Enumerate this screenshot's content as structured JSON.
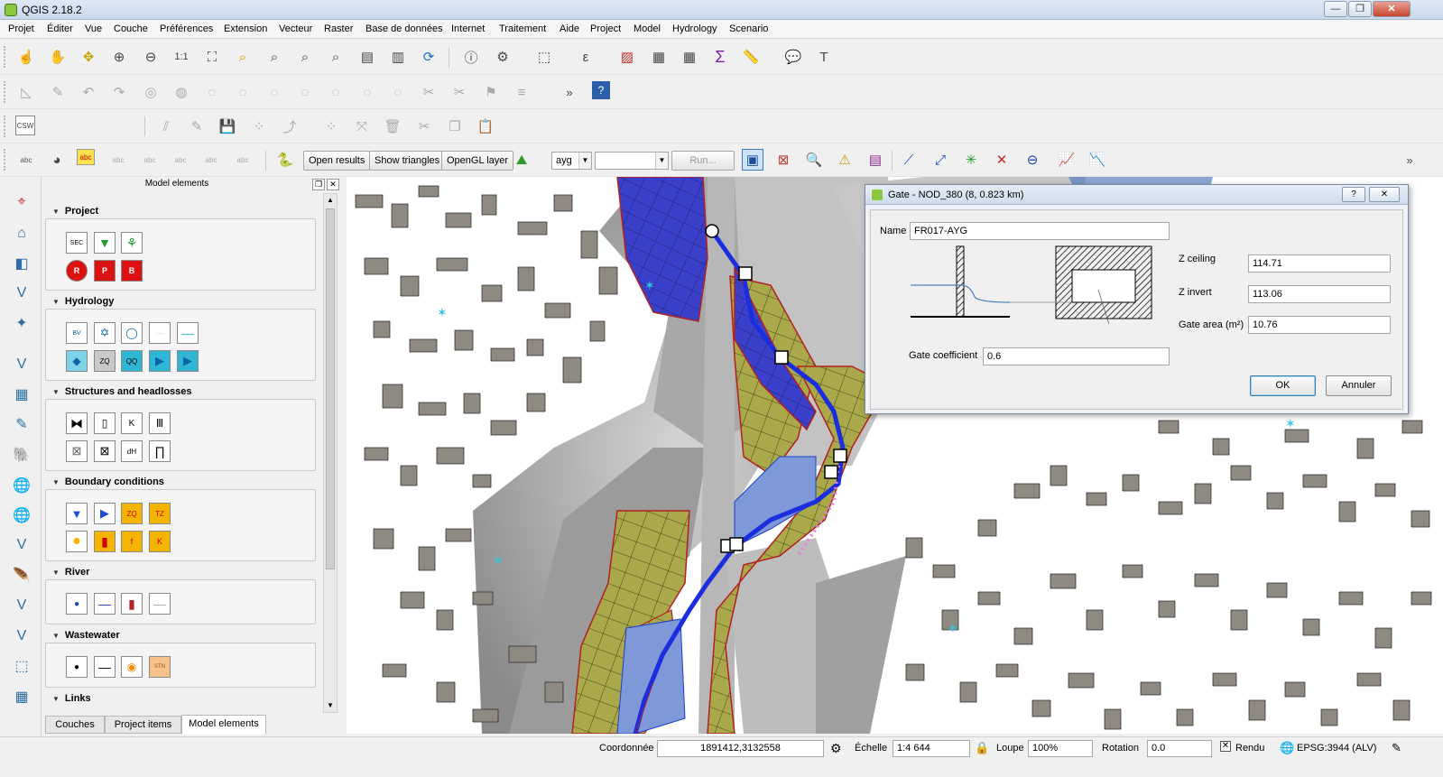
{
  "window": {
    "title": "QGIS 2.18.2"
  },
  "menu": [
    "Projet",
    "Éditer",
    "Vue",
    "Couche",
    "Préférences",
    "Extension",
    "Vecteur",
    "Raster",
    "Base de données",
    "Internet",
    "Traitement",
    "Aide",
    "Project",
    "Model",
    "Hydrology",
    "Scenario"
  ],
  "toolbar": {
    "csw_label": "CSW",
    "abc_label": "abc",
    "open_results": "Open results",
    "show_triangles": "Show triangles",
    "opengl_layer": "OpenGL layer",
    "scenario_value": "ayg",
    "model_value": "",
    "run_label": "Run...",
    "more": "»"
  },
  "panel": {
    "title": "Model elements",
    "groups": [
      {
        "name": "Project",
        "items": [
          "SEC",
          "filter",
          "tree",
          "R",
          "P",
          "B"
        ]
      },
      {
        "name": "Hydrology",
        "items": [
          "BV",
          "star",
          "circle",
          "dotted-line",
          "line",
          "diamond",
          "ZQ",
          "QQ",
          "arrow-q",
          "arrow-t"
        ]
      },
      {
        "name": "Structures and headlosses",
        "items": [
          "gate",
          "weir",
          "K",
          "grid",
          "gate-x",
          "valve",
          "dH",
          "bridge"
        ]
      },
      {
        "name": "Boundary conditions",
        "items": [
          "tri-down",
          "tri-right",
          "ZQ",
          "TZ",
          "circle",
          "wall",
          "f",
          "K"
        ]
      },
      {
        "name": "River",
        "items": [
          "node",
          "reach",
          "cross-section",
          "dash"
        ]
      },
      {
        "name": "Wastewater",
        "items": [
          "node",
          "pipe",
          "manhole",
          "STN"
        ]
      },
      {
        "name": "Links",
        "items": []
      }
    ],
    "tabs": [
      "Couches",
      "Project items",
      "Model elements"
    ],
    "active_tab": "Model elements"
  },
  "dialog": {
    "title": "Gate - NOD_380 (8, 0.823 km)",
    "help": "?",
    "name_label": "Name",
    "name_value": "FR017-AYG",
    "z_ceiling_label": "Z ceiling",
    "z_ceiling_value": "114.71",
    "z_invert_label": "Z invert",
    "z_invert_value": "113.06",
    "gate_area_label": "Gate area (m²)",
    "gate_area_value": "10.76",
    "gate_coeff_label": "Gate coefficient",
    "gate_coeff_value": "0.6",
    "ok_label": "OK",
    "cancel_label": "Annuler"
  },
  "statusbar": {
    "coord_label": "Coordonnée",
    "coord_value": "1891412,3132558",
    "scale_label": "Échelle",
    "scale_value": "1:4 644",
    "zoom_label": "Loupe",
    "zoom_value": "100%",
    "rotation_label": "Rotation",
    "rotation_value": "0.0",
    "render_label": "Rendu",
    "crs_label": "EPSG:3944 (ALV)"
  },
  "colors": {
    "accent_blue": "#2e3ee0",
    "mesh_olive": "#a9a84a",
    "river_red": "#b32020",
    "hillshade": "#bdbdbd",
    "building": "#8e8981"
  }
}
